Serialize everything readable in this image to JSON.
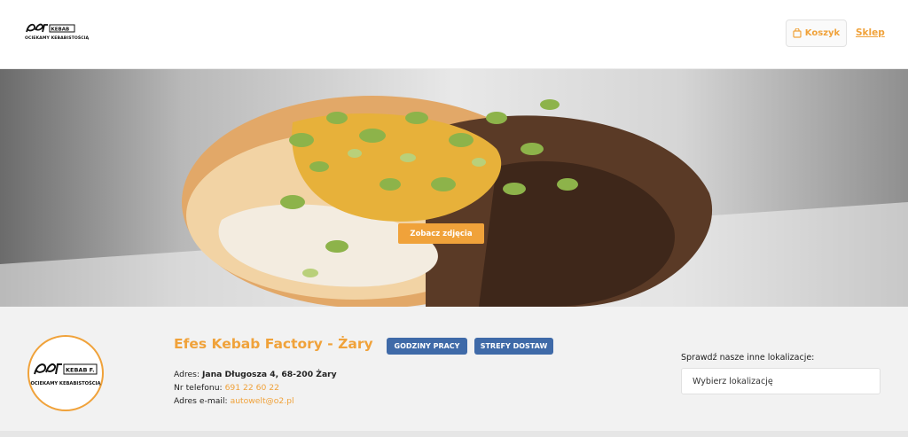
{
  "header": {
    "logo_mark": "Efes KEBAB FACTORY",
    "logo_slogan": "OCIEKAMY KEBABISTOŚCIĄ",
    "cart_label": "Koszyk",
    "cart_icon": "shopping-bag-icon",
    "shop_label": "Sklep"
  },
  "hero": {
    "photos_button": "Zobacz zdjęcia"
  },
  "restaurant": {
    "logo_mark": "Efes KEBAB FACTORY",
    "logo_slogan": "OCIEKAMY KEBABISTOŚCIĄ",
    "name": "Efes Kebab Factory - Żary",
    "hours_badge": "GODZINY PRACY",
    "zones_badge": "STREFY DOSTAW",
    "address_label": "Adres:",
    "address_value": "Jana Długosza 4, 68-200 Żary",
    "phone_label": "Nr telefonu:",
    "phone_value": "691 22 60 22",
    "email_label": "Adres e-mail:",
    "email_value": "autowelt@o2.pl"
  },
  "locations": {
    "label": "Sprawdź nasze inne lokalizacje:",
    "select_value": "Wybierz lokalizację"
  },
  "colors": {
    "accent": "#f0a23a",
    "badge": "#3f6aa8"
  }
}
